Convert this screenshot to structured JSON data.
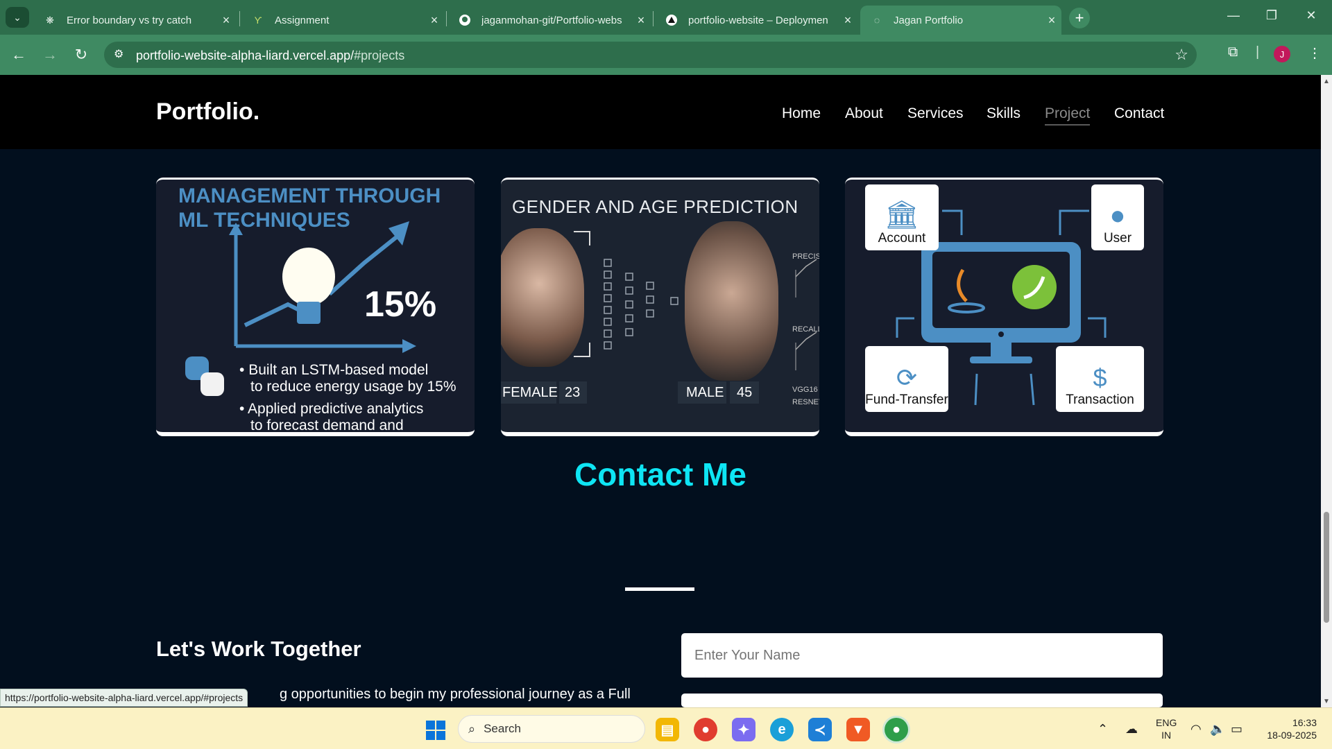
{
  "browser": {
    "tabs": [
      {
        "title": "Error boundary vs try catch",
        "icon": "openai-icon"
      },
      {
        "title": "Assignment",
        "icon": "app-icon"
      },
      {
        "title": "jaganmohan-git/Portfolio-webs",
        "icon": "github-icon"
      },
      {
        "title": "portfolio-website – Deploymen",
        "icon": "vercel-icon"
      },
      {
        "title": "Jagan Portfolio",
        "icon": "globe-icon",
        "active": true
      }
    ],
    "url_host": "portfolio-website-alpha-liard.vercel.app/",
    "url_path": "#projects",
    "avatar_letter": "J",
    "status_url": "https://portfolio-website-alpha-liard.vercel.app/#projects"
  },
  "site": {
    "logo": "Portfolio.",
    "nav": [
      "Home",
      "About",
      "Services",
      "Skills",
      "Project",
      "Contact"
    ],
    "active_nav": "Project"
  },
  "projects": {
    "card1": {
      "heading_line1": "MANAGEMENT THROUGH",
      "heading_line2": "ML TECHNIQUES",
      "percent": "15%",
      "bullet1_line1": "Built an LSTM-based model",
      "bullet1_line2": "to reduce energy usage by 15%",
      "bullet2_line1": "Applied predictive analytics",
      "bullet2_line2": "to forecast demand and"
    },
    "card2": {
      "heading": "GENDER AND AGE PREDICTION",
      "female_label": "FEMALE",
      "female_age": "23",
      "male_label": "MALE",
      "male_age": "45",
      "metric1": "PRECISI",
      "metric2": "RECALL",
      "model1": "VGG16",
      "model2": "RESNET"
    },
    "card3": {
      "account": "Account",
      "user": "User",
      "fund_transfer": "Fund-Transfer",
      "transaction": "Transaction"
    }
  },
  "contact": {
    "title": "Contact Me",
    "work_heading": "Let's Work Together",
    "work_text": "g opportunities to begin my professional journey as a Full",
    "name_placeholder": "Enter Your Name"
  },
  "taskbar": {
    "search": "Search",
    "lang_line1": "ENG",
    "lang_line2": "IN",
    "time": "16:33",
    "date": "18-09-2025"
  },
  "colors": {
    "browser_frame": "#2e6e4c",
    "contact_title": "#0ee5f4",
    "page_bg": "#020f1e",
    "card_heading_blue": "#4c8fc4"
  }
}
